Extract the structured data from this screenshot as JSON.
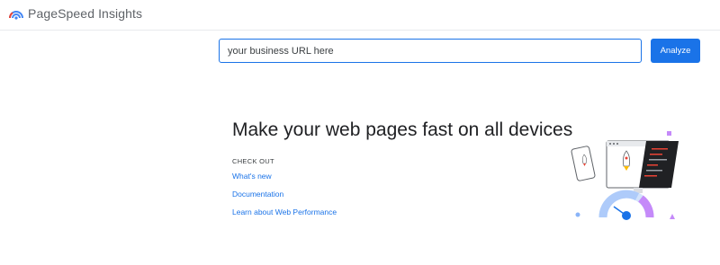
{
  "header": {
    "logo_icon": "pagespeed-gauge-icon",
    "app_title": "PageSpeed Insights"
  },
  "search": {
    "placeholder": "your business URL here",
    "analyze_label": "Analyze"
  },
  "main": {
    "headline": "Make your web pages fast on all devices",
    "check_out_label": "CHECK OUT",
    "links": [
      {
        "label": "What's new"
      },
      {
        "label": "Documentation"
      },
      {
        "label": "Learn about Web Performance"
      }
    ],
    "illustration_icon": "devices-speed-illustration-icon"
  },
  "colors": {
    "accent": "#1a73e8",
    "logo_red": "#ea4335",
    "logo_blue": "#4285f4"
  }
}
